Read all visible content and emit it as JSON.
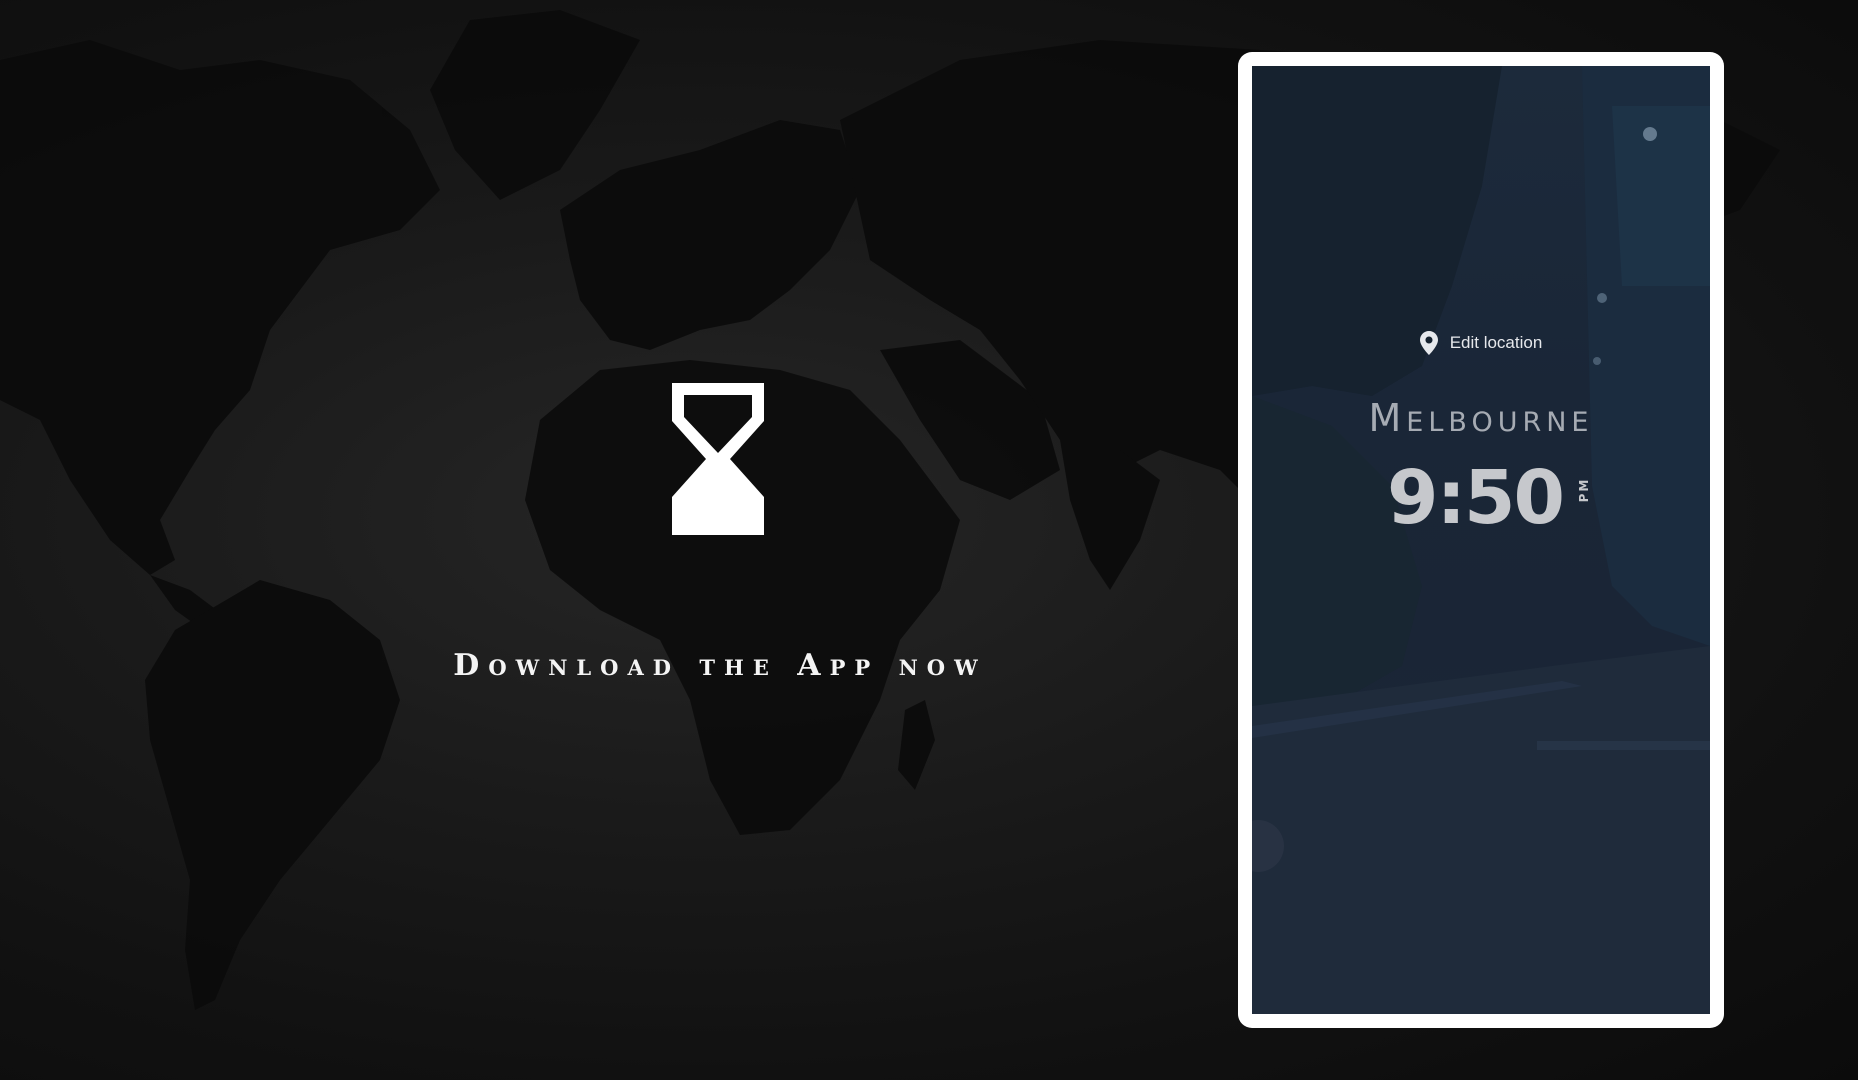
{
  "colors": {
    "page_background": "#141414",
    "map_land": "#0a0a0a",
    "cta_text": "#f4f4f4",
    "phone_frame": "#ffffff",
    "phone_screen": "#1a2536"
  },
  "hero": {
    "logo_icon": "hourglass-icon",
    "cta_text": "Download the App now"
  },
  "phone": {
    "location_icon": "map-pin-icon",
    "edit_location_label": "Edit location",
    "city": "Melbourne",
    "time": "9:50",
    "ampm": "PM"
  }
}
